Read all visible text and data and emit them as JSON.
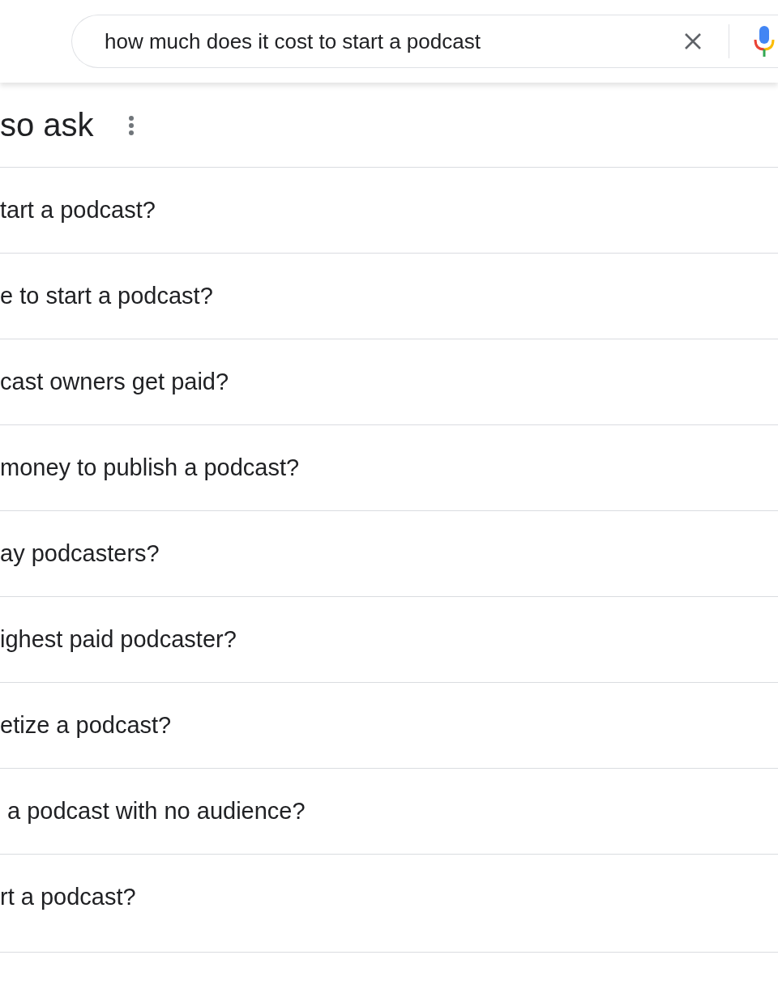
{
  "search": {
    "value": "how much does it cost to start a podcast"
  },
  "section": {
    "title": "so ask"
  },
  "questions": [
    "tart a podcast?",
    "e to start a podcast?",
    "cast owners get paid?",
    "money to publish a podcast?",
    "ay podcasters?",
    "ighest paid podcaster?",
    "etize a podcast?",
    "a podcast with no audience?",
    "rt a podcast?"
  ]
}
